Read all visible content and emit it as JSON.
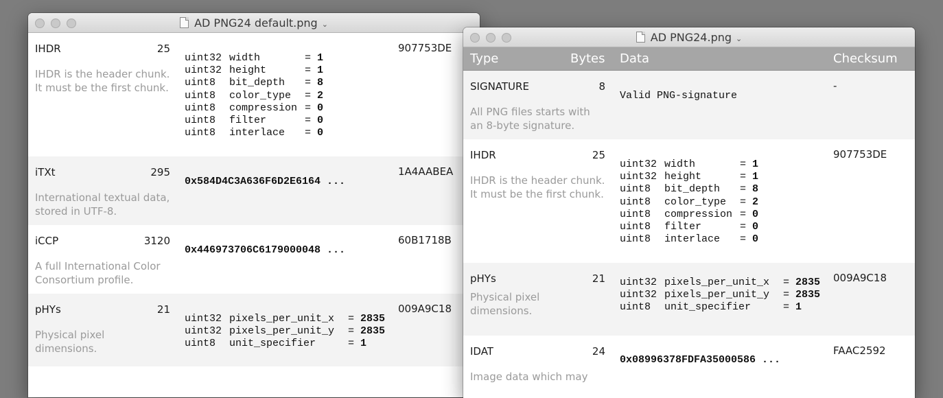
{
  "window1": {
    "title": "AD PNG24 default.png",
    "rows": [
      {
        "name": "IHDR",
        "bytes": "25",
        "desc": "IHDR is the header chunk.\nIt must be the first chunk.",
        "checksum": "907753DE",
        "fields": [
          [
            "uint32",
            "width",
            "1"
          ],
          [
            "uint32",
            "height",
            "1"
          ],
          [
            "uint8",
            "bit_depth",
            "8"
          ],
          [
            "uint8",
            "color_type",
            "2"
          ],
          [
            "uint8",
            "compression",
            "0"
          ],
          [
            "uint8",
            "filter",
            "0"
          ],
          [
            "uint8",
            "interlace",
            "0"
          ]
        ]
      },
      {
        "name": "iTXt",
        "bytes": "295",
        "desc": "International textual data,\nstored in UTF-8.",
        "checksum": "1A4AABEA",
        "hex": "0x584D4C3A636F6D2E6164 ..."
      },
      {
        "name": "iCCP",
        "bytes": "3120",
        "desc": "A full International Color\nConsortium profile.",
        "checksum": "60B1718B",
        "hex": "0x446973706C6179000048 ..."
      },
      {
        "name": "pHYs",
        "bytes": "21",
        "desc": "Physical pixel\ndimensions.",
        "checksum": "009A9C18",
        "fields": [
          [
            "uint32",
            "pixels_per_unit_x",
            "2835"
          ],
          [
            "uint32",
            "pixels_per_unit_y",
            "2835"
          ],
          [
            "uint8",
            "unit_specifier",
            "1"
          ]
        ]
      }
    ]
  },
  "window2": {
    "title": "AD PNG24.png",
    "columns": {
      "type": "Type",
      "bytes": "Bytes",
      "data": "Data",
      "checksum": "Checksum"
    },
    "rows": [
      {
        "name": "SIGNATURE",
        "bytes": "8",
        "desc": "All PNG files starts with\nan 8-byte signature.",
        "checksum": "-",
        "text": "Valid PNG-signature"
      },
      {
        "name": "IHDR",
        "bytes": "25",
        "desc": "IHDR is the header chunk.\nIt must be the first chunk.",
        "checksum": "907753DE",
        "fields": [
          [
            "uint32",
            "width",
            "1"
          ],
          [
            "uint32",
            "height",
            "1"
          ],
          [
            "uint8",
            "bit_depth",
            "8"
          ],
          [
            "uint8",
            "color_type",
            "2"
          ],
          [
            "uint8",
            "compression",
            "0"
          ],
          [
            "uint8",
            "filter",
            "0"
          ],
          [
            "uint8",
            "interlace",
            "0"
          ]
        ]
      },
      {
        "name": "pHYs",
        "bytes": "21",
        "desc": "Physical pixel\ndimensions.",
        "checksum": "009A9C18",
        "fields": [
          [
            "uint32",
            "pixels_per_unit_x",
            "2835"
          ],
          [
            "uint32",
            "pixels_per_unit_y",
            "2835"
          ],
          [
            "uint8",
            "unit_specifier",
            "1"
          ]
        ]
      },
      {
        "name": "IDAT",
        "bytes": "24",
        "desc": "Image data which may",
        "checksum": "FAAC2592",
        "hex": "0x08996378FDFA35000586 ..."
      }
    ]
  }
}
